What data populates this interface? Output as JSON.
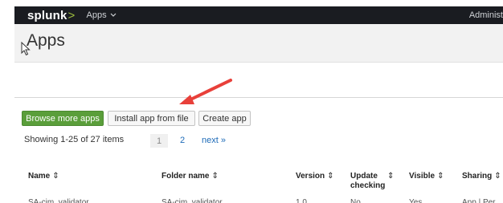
{
  "topbar": {
    "logo_main": "splunk",
    "logo_chevron": ">",
    "apps_menu": "Apps",
    "user": "Administ"
  },
  "header": {
    "title": "Apps"
  },
  "buttons": {
    "browse": "Browse more apps",
    "install": "Install app from file",
    "create": "Create app"
  },
  "pagination": {
    "summary": "Showing 1-25 of 27 items",
    "current": "1",
    "page2": "2",
    "next": "next »"
  },
  "table": {
    "columns": [
      {
        "label": "Name",
        "sort": "⇕"
      },
      {
        "label": "Folder name",
        "sort": "⇕"
      },
      {
        "label": "Version",
        "sort": "⇕"
      },
      {
        "label": "Update checking",
        "sort": "⇕"
      },
      {
        "label": "Visible",
        "sort": "⇕"
      },
      {
        "label": "Sharing",
        "sort": "⇕"
      }
    ],
    "first_row": [
      "SA-cim_validator",
      "SA-cim_validator",
      "1.0",
      "No",
      "Yes",
      "App | Per"
    ]
  },
  "colors": {
    "topbar": "#1a1c21",
    "green_button": "#5a9e3a",
    "link": "#1e6bb8",
    "arrow": "#e8403a"
  }
}
